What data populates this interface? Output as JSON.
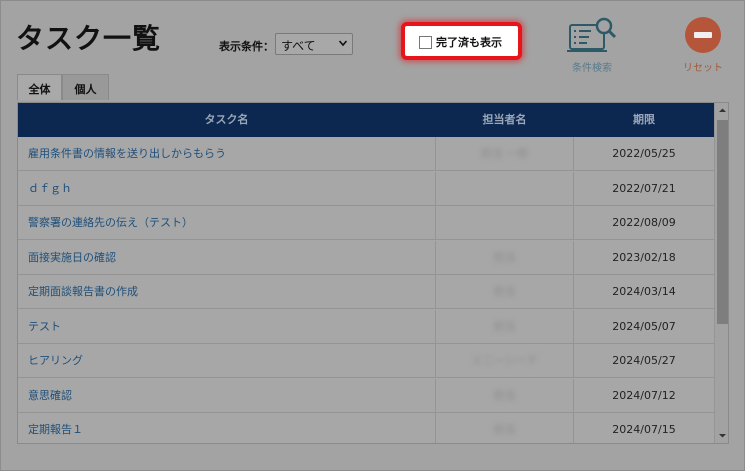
{
  "page": {
    "title": "タスク一覧",
    "filter_label": "表示条件：",
    "filter_value": "すべて",
    "show_completed_label": "完了済も表示",
    "show_completed_checked": false,
    "search_label": "条件検索",
    "reset_label": "リセット",
    "search_icon": "search-list-icon",
    "reset_icon": "minus-circle-icon"
  },
  "tabs": [
    {
      "label": "全体",
      "active": true
    },
    {
      "label": "個人",
      "active": false
    }
  ],
  "table": {
    "headers": {
      "name": "タスク名",
      "assignee": "担当者名",
      "deadline": "期限"
    },
    "rows": [
      {
        "name": "雇用条件書の情報を送り出しからもらう",
        "assignee": "担当 一郎",
        "deadline": "2022/05/25"
      },
      {
        "name": "ｄｆｇｈ",
        "assignee": "",
        "deadline": "2022/07/21"
      },
      {
        "name": "警察署の連絡先の伝え（テスト）",
        "assignee": "",
        "deadline": "2022/08/09"
      },
      {
        "name": "面接実施日の確認",
        "assignee": "担当",
        "deadline": "2023/02/18"
      },
      {
        "name": "定期面談報告書の作成",
        "assignee": "担当",
        "deadline": "2024/03/14"
      },
      {
        "name": "テスト",
        "assignee": "担当",
        "deadline": "2024/05/07"
      },
      {
        "name": "ヒアリング",
        "assignee": "ミ二ーシーデ",
        "deadline": "2024/05/27"
      },
      {
        "name": "意思確認",
        "assignee": "担当",
        "deadline": "2024/07/12"
      },
      {
        "name": "定期報告１",
        "assignee": "担当",
        "deadline": "2024/07/15"
      }
    ]
  },
  "colors": {
    "header_bg": "#0d2850",
    "highlight": "#e8141b",
    "link": "#1f4f7a",
    "reset": "#b5553a"
  }
}
